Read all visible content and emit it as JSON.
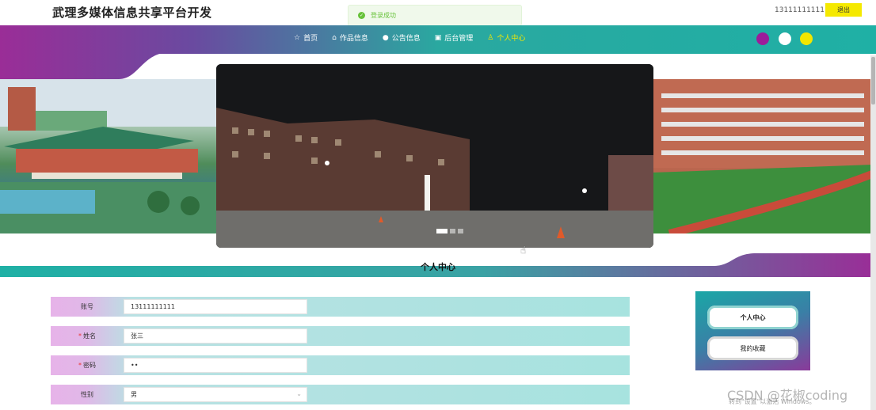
{
  "header": {
    "site_title": "武理多媒体信息共享平台开发",
    "toast": "登录成功",
    "account": "13111111111",
    "logout_label": "退出"
  },
  "nav": {
    "items": [
      {
        "label": "首页",
        "icon": "star-outline-icon",
        "glyph": "☆"
      },
      {
        "label": "作品信息",
        "icon": "home-icon",
        "glyph": "⌂"
      },
      {
        "label": "公告信息",
        "icon": "circle-icon",
        "glyph": "●"
      },
      {
        "label": "后台管理",
        "icon": "dashboard-icon",
        "glyph": "▣"
      },
      {
        "label": "个人中心",
        "icon": "user-icon",
        "glyph": "♙"
      }
    ],
    "active_index": 4
  },
  "theme_colors": [
    "#9c1c9a",
    "#ffffff",
    "#f2e600"
  ],
  "banner": {
    "slide_count": 3,
    "active_slide": 0
  },
  "section": {
    "title": "个人中心"
  },
  "form": {
    "fields": [
      {
        "label": "账号",
        "required": false,
        "value": "13111111111"
      },
      {
        "label": "姓名",
        "required": true,
        "value": "张三"
      },
      {
        "label": "密码",
        "required": true,
        "value": "••"
      },
      {
        "label": "性别",
        "required": false,
        "value": "男",
        "type": "select"
      }
    ]
  },
  "side_menu": {
    "items": [
      {
        "label": "个人中心",
        "active": true
      },
      {
        "label": "我的收藏",
        "active": false
      }
    ]
  },
  "overlay": {
    "watermark": "CSDN @花椒coding",
    "windows_activation": "转到\"设置\"以激活 Windows。"
  },
  "colors": {
    "accent_yellow": "#f5e900",
    "nav_teal": "#1fb0a5",
    "nav_purple": "#9a2d97",
    "toast_green": "#67c23a"
  }
}
